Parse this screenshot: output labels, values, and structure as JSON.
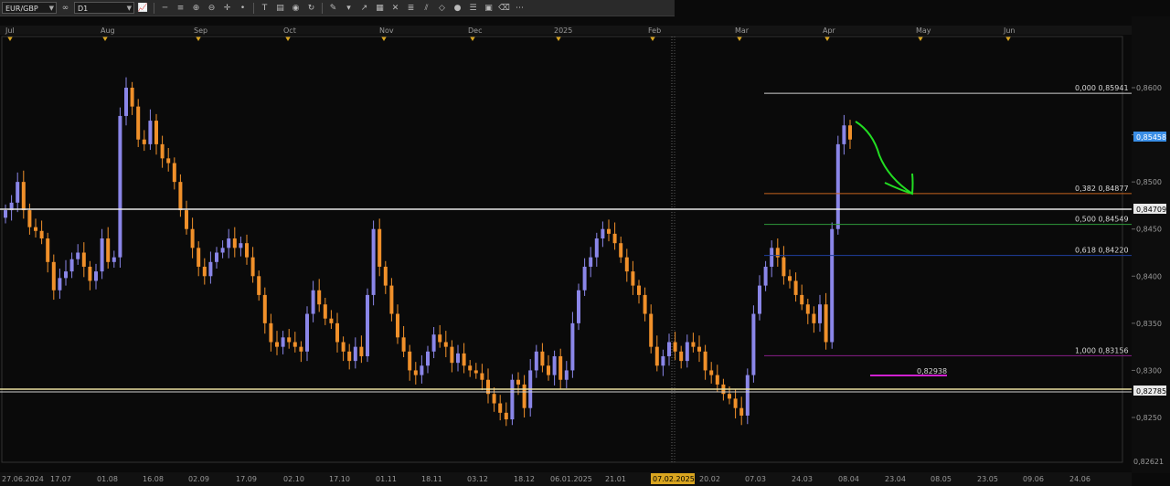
{
  "toolbar": {
    "symbol": "EUR/GBP",
    "timeframe": "D1"
  },
  "top_months": [
    "Jul",
    "Aug",
    "Sep",
    "Oct",
    "Nov",
    "Dec",
    "2025",
    "Feb",
    "Mar",
    "Apr",
    "May",
    "Jun"
  ],
  "bottom_dates": [
    "27.06.2024",
    "17.07",
    "01.08",
    "16.08",
    "02.09",
    "17.09",
    "02.10",
    "17.10",
    "01.11",
    "18.11",
    "03.12",
    "18.12",
    "06.01.2025",
    "21.01",
    "07.02.2025",
    "20.02",
    "07.03",
    "24.03",
    "08.04",
    "23.04",
    "08.05",
    "23.05",
    "09.06",
    "24.06"
  ],
  "highlighted_date": "07.02.2025",
  "price_labels": [
    "0,8600",
    "0,8550",
    "0,8500",
    "0,8450",
    "0,8400",
    "0,8350",
    "0,8300",
    "0,8250"
  ],
  "current_price": "0,85458",
  "level_upper": "0,84709",
  "level_lower": "0,82785",
  "bottom_cut_label": "0,82621",
  "fib_levels": [
    {
      "label": "0,000 0,85941",
      "value": 0.85941,
      "color": "#cfcfcf"
    },
    {
      "label": "0,382 0,84877",
      "value": 0.84877,
      "color": "#c8641e"
    },
    {
      "label": "0,500 0,84549",
      "value": 0.84549,
      "color": "#2e9a3a"
    },
    {
      "label": "0,618 0,84220",
      "value": 0.8422,
      "color": "#2040a0"
    },
    {
      "label": "1,000 0,83156",
      "value": 0.83156,
      "color": "#8a1e8a"
    }
  ],
  "magenta_level": {
    "label": "0,82938",
    "value": 0.82938
  },
  "colors": {
    "bull": "#8a86e8",
    "bear": "#f0902a",
    "background": "#0a0a0a",
    "current_price_bg": "#3a8ee6",
    "annotation": "#22dd22"
  },
  "chart_data": {
    "type": "candlestick",
    "symbol": "EUR/GBP",
    "timeframe": "D1",
    "x_range": [
      "27.06.2024",
      "24.06.2025"
    ],
    "ylim": [
      0.8225,
      0.863
    ],
    "closes": [
      0.847,
      0.8478,
      0.85,
      0.847,
      0.8452,
      0.8448,
      0.844,
      0.8415,
      0.8385,
      0.8398,
      0.8405,
      0.8418,
      0.8425,
      0.841,
      0.8395,
      0.8405,
      0.844,
      0.8415,
      0.842,
      0.857,
      0.86,
      0.858,
      0.8545,
      0.854,
      0.8565,
      0.854,
      0.8525,
      0.852,
      0.85,
      0.847,
      0.845,
      0.843,
      0.841,
      0.84,
      0.8415,
      0.8425,
      0.843,
      0.844,
      0.843,
      0.8435,
      0.842,
      0.84,
      0.838,
      0.835,
      0.833,
      0.8325,
      0.8335,
      0.833,
      0.8325,
      0.832,
      0.836,
      0.8385,
      0.837,
      0.8355,
      0.835,
      0.833,
      0.832,
      0.831,
      0.8325,
      0.8315,
      0.838,
      0.845,
      0.841,
      0.839,
      0.836,
      0.8335,
      0.832,
      0.83,
      0.8295,
      0.8305,
      0.832,
      0.8338,
      0.833,
      0.8325,
      0.8308,
      0.8318,
      0.8305,
      0.83,
      0.8297,
      0.829,
      0.8275,
      0.8265,
      0.8255,
      0.8248,
      0.829,
      0.8285,
      0.826,
      0.83,
      0.832,
      0.8305,
      0.8295,
      0.8315,
      0.829,
      0.83,
      0.835,
      0.8385,
      0.841,
      0.842,
      0.844,
      0.845,
      0.8445,
      0.8435,
      0.842,
      0.8405,
      0.839,
      0.838,
      0.836,
      0.8325,
      0.8305,
      0.8315,
      0.833,
      0.832,
      0.831,
      0.833,
      0.8325,
      0.832,
      0.83,
      0.8295,
      0.8285,
      0.8275,
      0.827,
      0.826,
      0.8252,
      0.8295,
      0.836,
      0.839,
      0.841,
      0.843,
      0.842,
      0.84,
      0.8395,
      0.838,
      0.837,
      0.836,
      0.835,
      0.837,
      0.833,
      0.845,
      0.854,
      0.856,
      0.8545
    ]
  }
}
